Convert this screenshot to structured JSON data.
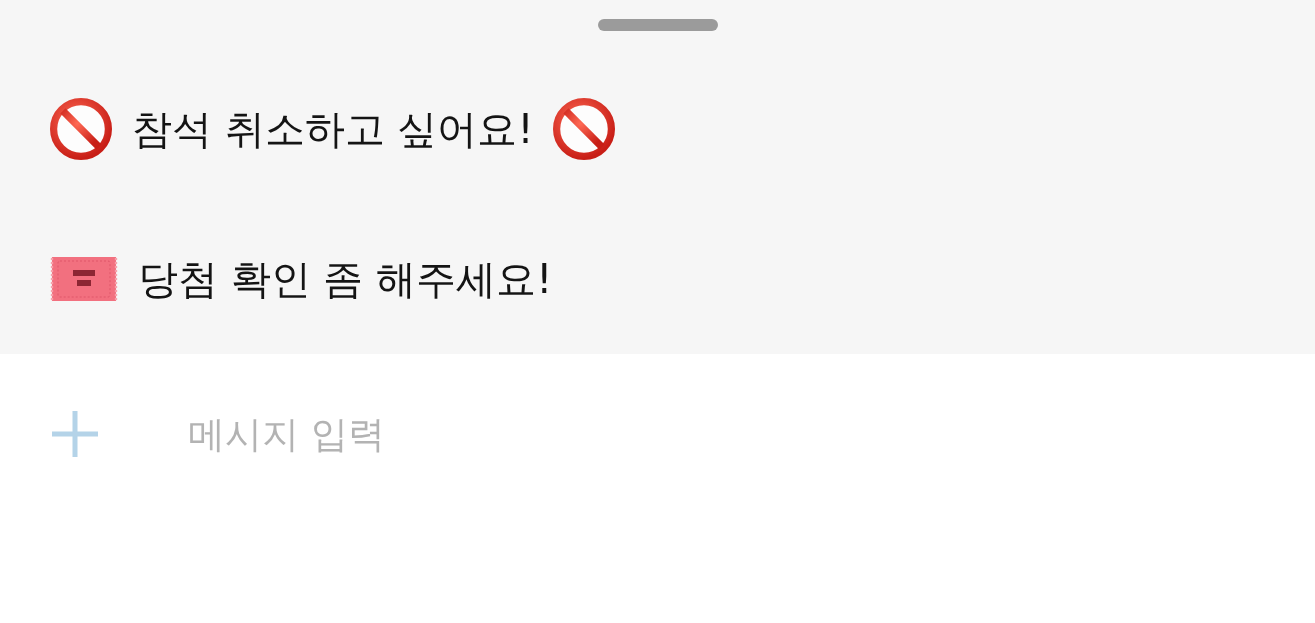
{
  "quick_replies": [
    {
      "kind": "cancel",
      "text": "참석 취소하고 싶어요!"
    },
    {
      "kind": "ticket",
      "text": "당첨 확인 좀 해주세요!"
    }
  ],
  "composer": {
    "placeholder": "메시지 입력"
  }
}
